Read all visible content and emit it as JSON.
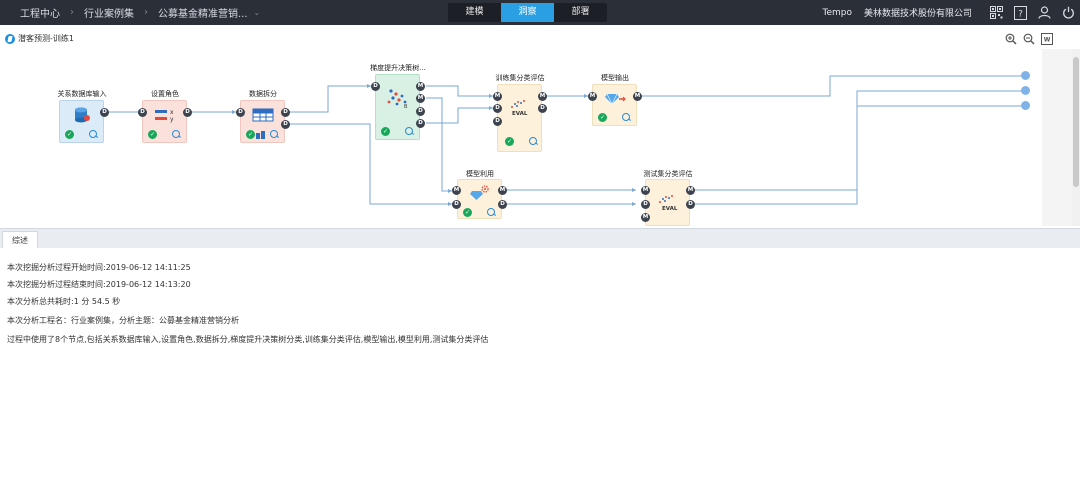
{
  "topbar": {
    "breadcrumbs": [
      "工程中心",
      "行业案例集",
      "公募基金精准营销..."
    ],
    "modes": [
      {
        "label": "建模",
        "active": false
      },
      {
        "label": "洞察",
        "active": true
      },
      {
        "label": "部署",
        "active": false
      }
    ],
    "user": "Tempo",
    "company": "美林数据技术股份有限公司",
    "icons": [
      "qr-code-icon",
      "help-icon",
      "user-icon",
      "power-icon"
    ]
  },
  "canvas": {
    "model_title": "潜客预测-训练1",
    "zoom_tools": [
      "zoom-in-icon",
      "zoom-out-icon",
      "export-word-icon"
    ],
    "nodes": [
      {
        "id": "db",
        "label": "关系数据库输入"
      },
      {
        "id": "role",
        "label": "设置角色"
      },
      {
        "id": "split",
        "label": "数据拆分"
      },
      {
        "id": "gbdt",
        "label": "梯度提升决策树..."
      },
      {
        "id": "train_eval",
        "label": "训练集分类评估"
      },
      {
        "id": "model_out",
        "label": "模型输出"
      },
      {
        "id": "model_use",
        "label": "模型利用"
      },
      {
        "id": "test_eval",
        "label": "测试集分类评估"
      }
    ],
    "port_labels": {
      "data": "D",
      "model": "M"
    },
    "eval_text": "EVAL",
    "role_text": {
      "x": "x",
      "y": "y"
    }
  },
  "summary": {
    "tab": "综述",
    "lines": [
      "本次挖掘分析过程开始时间:2019-06-12 14:11:25",
      "本次挖掘分析过程结束时间:2019-06-12 14:13:20",
      "本次分析总共耗时:1 分 54.5 秒",
      "本次分析工程名：行业案例集，分析主题：公募基金精准营销分析",
      "过程中使用了8个节点,包括关系数据库输入,设置角色,数据拆分,梯度提升决策树分类,训练集分类评估,模型输出,模型利用,测试集分类评估"
    ]
  },
  "colors": {
    "accent": "#2a9fe4",
    "topbar": "#2b2f38",
    "ok": "#19a85a"
  }
}
